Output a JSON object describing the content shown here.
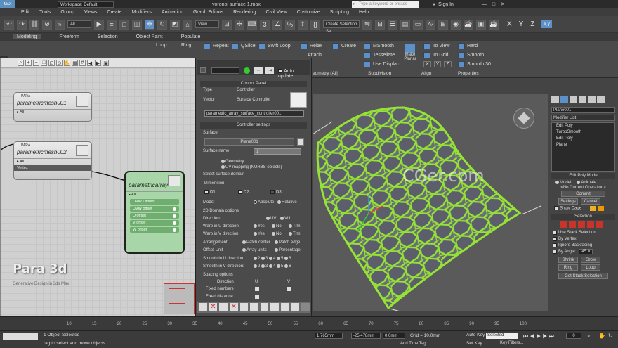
{
  "title": {
    "logo": "MAX",
    "workspace": "Workspace: Default",
    "window_title": "voronoi surface 1.max",
    "search_placeholder": "Type a keyword or phrase",
    "sign_in": "Sign In"
  },
  "menu": [
    "Edit",
    "Tools",
    "Group",
    "Views",
    "Create",
    "Modifiers",
    "Animation",
    "Graph Editors",
    "Rendering",
    "Civil View",
    "Customize",
    "Scripting",
    "Help"
  ],
  "toolbar": {
    "filter_all": "All",
    "view": "View",
    "selection_set": "Create Selection Se",
    "axes": [
      "X",
      "Y",
      "Z",
      "XY"
    ]
  },
  "ribbon_tabs": [
    "Modeling",
    "Freeform",
    "Selection",
    "Object Paint",
    "Populate"
  ],
  "ribbon": {
    "row1": [
      "Repeat",
      "QSlice",
      "Swift Loop",
      "Relax",
      "Create",
      "MSmooth",
      "To View",
      "Hard"
    ],
    "row2": [
      "Attach",
      "Tessellate",
      "To Grid",
      "Smooth"
    ],
    "row3": [
      "Use Displac...",
      "Smooth 30"
    ],
    "make_planar": "Make Planar",
    "groups": [
      "eometry (All)",
      "Subdivision",
      "Align",
      "Properties"
    ],
    "xyz": [
      "X",
      "Y",
      "Z"
    ],
    "loop": "Loop",
    "ring": "Ring"
  },
  "slate": {
    "nodes": [
      {
        "tag": "PARA",
        "title": "parametricmesh001",
        "rows": [
          "All"
        ]
      },
      {
        "tag": "PARA",
        "title": "parametricmesh002",
        "rows": [
          "All",
          "Vertex"
        ]
      }
    ],
    "array_node": {
      "title": "parametricarray",
      "rows": [
        "All",
        "UVW Offsets",
        "UVW offset",
        "U offset",
        "V offset",
        "W offset"
      ]
    },
    "watermark": "Para 3d",
    "watermark_sub": "Generative Design in 3ds Max"
  },
  "control_panel": {
    "auto_update": "Auto update",
    "header": "Control Panel",
    "type_label": "Type",
    "type_value": "Vector",
    "controller_label": "Controller",
    "controller_value": "Surface Controller",
    "controller_name": "parametric_array_surface_controller001",
    "settings_header": "Controller settings",
    "surface_label": "Surface",
    "surface_value": "Plane001",
    "surface_name_label": "Surface name",
    "surface_name_value": "1",
    "geometry_opt": "Geometry",
    "uv_opt": "UV mapping (NURBS objects)",
    "select_domain": "Select surface domain",
    "dimension": "Dimension",
    "d1": "D1.",
    "d2": "D2.",
    "d3": "D3.",
    "mode_label": "Mode:",
    "absolute": "Absolute",
    "relative": "Relative",
    "domain_header": "2D Domain options",
    "direction_label": "Direction:",
    "uv": "UV",
    "vu": "VU",
    "warp_u": "Warp in U direction:",
    "warp_v": "Warp in V direction:",
    "yes": "Yes",
    "no": "No",
    "trim": "Trm",
    "arrangement": "Arrangement:",
    "patch_center": "Patch center",
    "patch_edge": "Patch edge",
    "offset_unit": "Offset Unit",
    "array_units": "Array units",
    "percentage": "Percentage",
    "smooth_u": "Smooth in U direction:",
    "smooth_v": "Smooth in V direction:",
    "smooth_vals": [
      "2",
      "3",
      "4",
      "5",
      "6"
    ],
    "spacing_header": "Spacing options",
    "direction": "Direction",
    "u_col": "U",
    "v_col": "V",
    "fixed_numbers": "Fixed numbers",
    "fixed_distance": "Fixed distance"
  },
  "viewport": {
    "watermark": "CGer.com"
  },
  "right_panel": {
    "object_name": "Plane001",
    "modifier_list": "Modifier List",
    "stack": [
      "Edit Poly",
      "TurboSmooth",
      "Edit Poly",
      "Plane"
    ],
    "edit_poly_mode": "Edit Poly Mode",
    "model": "Model",
    "animate": "Animate",
    "no_op": "<No Current Operation>",
    "commit": "Commit",
    "settings": "Settings",
    "cancel": "Cancel",
    "show_cage": "Show Cage",
    "selection": "Selection",
    "use_stack": "Use Stack Selection",
    "by_vertex": "By Vertex",
    "ignore_back": "Ignore Backfacing",
    "by_angle": "By Angle:",
    "angle_val": "45.0",
    "shrink": "Shrink",
    "grow": "Grow",
    "ring": "Ring",
    "loop": "Loop",
    "get_stack": "Get Stack Selection"
  },
  "timeline": {
    "ticks": [
      "10",
      "15",
      "20",
      "25",
      "30",
      "35",
      "40",
      "45",
      "50",
      "55",
      "60",
      "65",
      "70",
      "75",
      "80",
      "85",
      "90",
      "95",
      "100"
    ]
  },
  "status": {
    "selected": "1 Object Selected",
    "hint": "rag to select and move objects",
    "x_val": "1.765mm",
    "y_val": "-25.478mm",
    "z_val": "0.0mm",
    "grid": "Grid = 10.0mm",
    "add_time_tag": "Add Time Tag",
    "auto_key": "Auto Key",
    "set_key": "Set Key",
    "selected_dd": "Selected",
    "key_filters": "Key Filters...",
    "frame": "0"
  },
  "colors": {
    "accent_red": "#c8342a",
    "node_green": "#a8d6a8",
    "mesh_green": "#8ddc2e"
  }
}
